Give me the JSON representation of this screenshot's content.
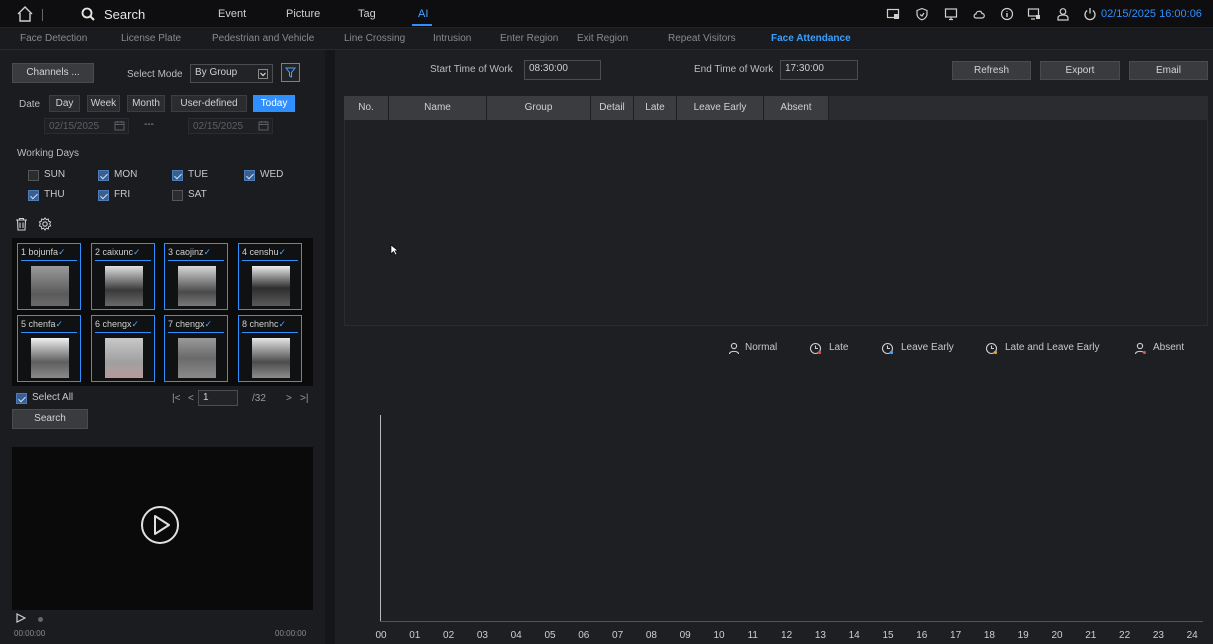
{
  "topbar": {
    "search_title": "Search",
    "tabs": [
      "Event",
      "Picture",
      "Tag",
      "AI"
    ],
    "datetime": "02/15/2025 16:00:06"
  },
  "subtabs": [
    "Face Detection",
    "License Plate",
    "Pedestrian and Vehicle",
    "Line Crossing",
    "Intrusion",
    "Enter Region",
    "Exit Region",
    "Repeat Visitors",
    "Face Attendance"
  ],
  "left": {
    "channels_label": "Channels ...",
    "select_mode_label": "Select Mode",
    "select_mode_value": "By Group",
    "date_label": "Date",
    "date_tabs": [
      "Day",
      "Week",
      "Month",
      "User-defined",
      "Today"
    ],
    "start_date": "02/15/2025",
    "date_sep": "---",
    "end_date": "02/15/2025",
    "working_days_label": "Working Days",
    "days": [
      {
        "name": "SUN",
        "checked": false
      },
      {
        "name": "MON",
        "checked": true
      },
      {
        "name": "TUE",
        "checked": true
      },
      {
        "name": "WED",
        "checked": true
      },
      {
        "name": "THU",
        "checked": true
      },
      {
        "name": "FRI",
        "checked": true
      },
      {
        "name": "SAT",
        "checked": false
      }
    ],
    "faces": [
      "1 bojunfa",
      "2 caixunc",
      "3 caojinz",
      "4 censhu",
      "5 chenfa",
      "6 chengx",
      "7 chengx",
      "8 chenhc"
    ],
    "select_all": "Select All",
    "page_current": "1",
    "page_total": "/32",
    "search_button": "Search",
    "time_start": "00:00:00",
    "time_end": "00:00:00"
  },
  "right": {
    "start_label": "Start Time of Work",
    "start_value": "08:30:00",
    "end_label": "End Time of Work",
    "end_value": "17:30:00",
    "refresh": "Refresh",
    "export": "Export",
    "email": "Email",
    "columns": [
      "No.",
      "Name",
      "Group",
      "Detail",
      "Late",
      "Leave Early",
      "Absent"
    ],
    "legend": [
      "Normal",
      "Late",
      "Leave Early",
      "Late and Leave Early",
      "Absent"
    ],
    "hours": [
      "00",
      "01",
      "02",
      "03",
      "04",
      "05",
      "06",
      "07",
      "08",
      "09",
      "10",
      "11",
      "12",
      "13",
      "14",
      "15",
      "16",
      "17",
      "18",
      "19",
      "20",
      "21",
      "22",
      "23",
      "24"
    ]
  }
}
